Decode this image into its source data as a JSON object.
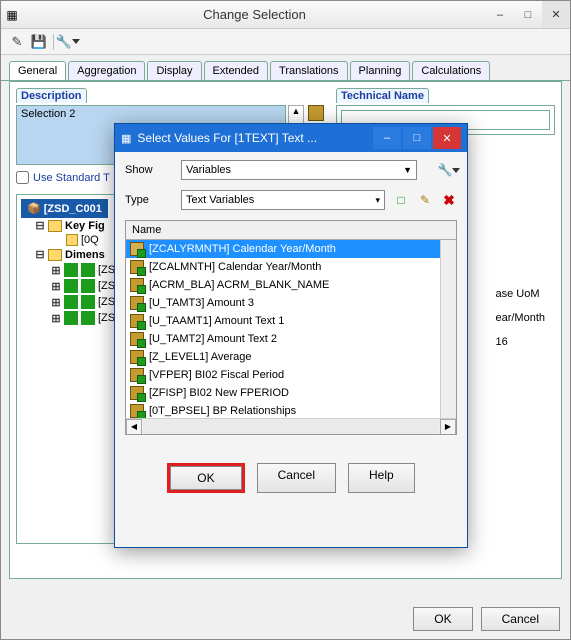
{
  "main": {
    "title": "Change Selection",
    "tabs": [
      "General",
      "Aggregation",
      "Display",
      "Extended",
      "Translations",
      "Planning",
      "Calculations"
    ],
    "activeTab": "General",
    "description_label": "Description",
    "description_value": "Selection 2",
    "technical_label": "Technical Name",
    "technical_value": "",
    "use_standard_label": "Use Standard T",
    "tree_header": "[ZSD_C001",
    "tree": {
      "keyfig": "Key Fig",
      "keyfig_child": "[0Q",
      "dimens": "Dimens",
      "dimens_children": [
        "[ZS",
        "[ZS",
        "[ZS",
        "[ZS"
      ]
    },
    "side": {
      "l1": "ase UoM",
      "l2": "ear/Month",
      "l3": "16"
    },
    "ok": "OK",
    "cancel": "Cancel"
  },
  "modal": {
    "title": "Select Values For [1TEXT] Text ...",
    "show_label": "Show",
    "show_value": "Variables",
    "type_label": "Type",
    "type_value": "Text Variables",
    "name_hdr": "Name",
    "items": [
      "[ZCALYRMNTH] Calendar Year/Month",
      "[ZCALMNTH] Calendar Year/Month",
      "[ACRM_BLA] ACRM_BLANK_NAME",
      "[U_TAMT3] Amount 3",
      "[U_TAAMT1] Amount Text 1",
      "[U_TAMT2] Amount Text 2",
      "[Z_LEVEL1] Average",
      "[VFPER] BI02 Fiscal Period",
      "[ZFISP] BI02 New FPERIOD",
      "[0T_BPSEL] BP Relationships"
    ],
    "selected": 0,
    "ok": "OK",
    "cancel": "Cancel",
    "help": "Help"
  }
}
